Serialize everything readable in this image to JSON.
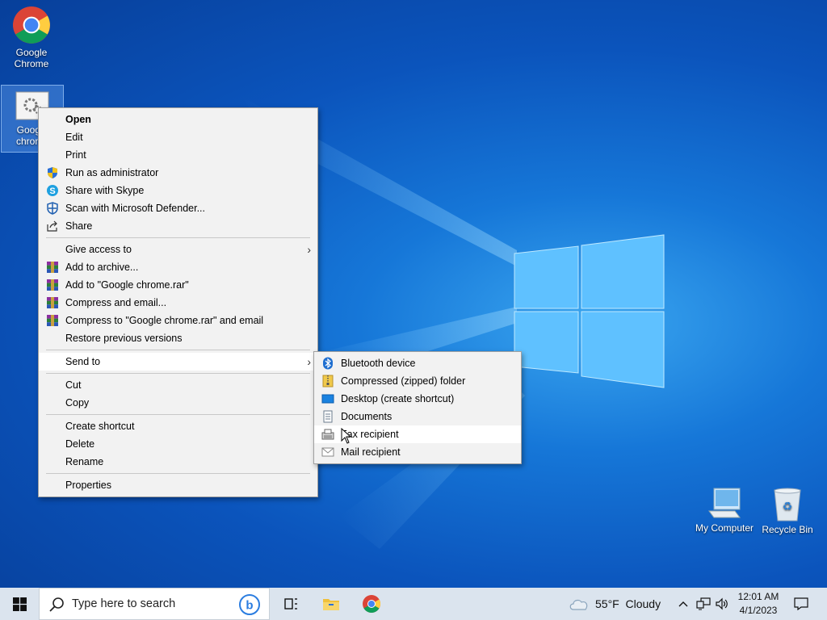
{
  "desktop": {
    "icons": [
      {
        "label": "Google Chrome"
      },
      {
        "label": "Google chrome"
      },
      {
        "label": "My Computer"
      },
      {
        "label": "Recycle Bin"
      }
    ]
  },
  "context_menu": {
    "items": [
      {
        "label": "Open"
      },
      {
        "label": "Edit"
      },
      {
        "label": "Print"
      },
      {
        "label": "Run as administrator",
        "icon": "shield-icon"
      },
      {
        "label": "Share with Skype",
        "icon": "skype-icon"
      },
      {
        "label": "Scan with Microsoft Defender...",
        "icon": "defender-icon"
      },
      {
        "label": "Share",
        "icon": "share-icon"
      },
      {
        "label": "Give access to"
      },
      {
        "label": "Add to archive...",
        "icon": "winrar-icon"
      },
      {
        "label": "Add to \"Google chrome.rar\"",
        "icon": "winrar-icon"
      },
      {
        "label": "Compress and email...",
        "icon": "winrar-icon"
      },
      {
        "label": "Compress to \"Google chrome.rar\" and email",
        "icon": "winrar-icon"
      },
      {
        "label": "Restore previous versions"
      },
      {
        "label": "Send to"
      },
      {
        "label": "Cut"
      },
      {
        "label": "Copy"
      },
      {
        "label": "Create shortcut"
      },
      {
        "label": "Delete"
      },
      {
        "label": "Rename"
      },
      {
        "label": "Properties"
      }
    ]
  },
  "send_to_menu": {
    "items": [
      {
        "label": "Bluetooth device",
        "icon": "bluetooth-icon"
      },
      {
        "label": "Compressed (zipped) folder",
        "icon": "zip-folder-icon"
      },
      {
        "label": "Desktop (create shortcut)",
        "icon": "desktop-icon"
      },
      {
        "label": "Documents",
        "icon": "documents-icon"
      },
      {
        "label": "Fax recipient",
        "icon": "fax-icon"
      },
      {
        "label": "Mail recipient",
        "icon": "mail-icon"
      }
    ]
  },
  "taskbar": {
    "search_placeholder": "Type here to search",
    "weather": "55°F  Cloudy",
    "time": "12:01 AM",
    "date": "4/1/2023"
  }
}
